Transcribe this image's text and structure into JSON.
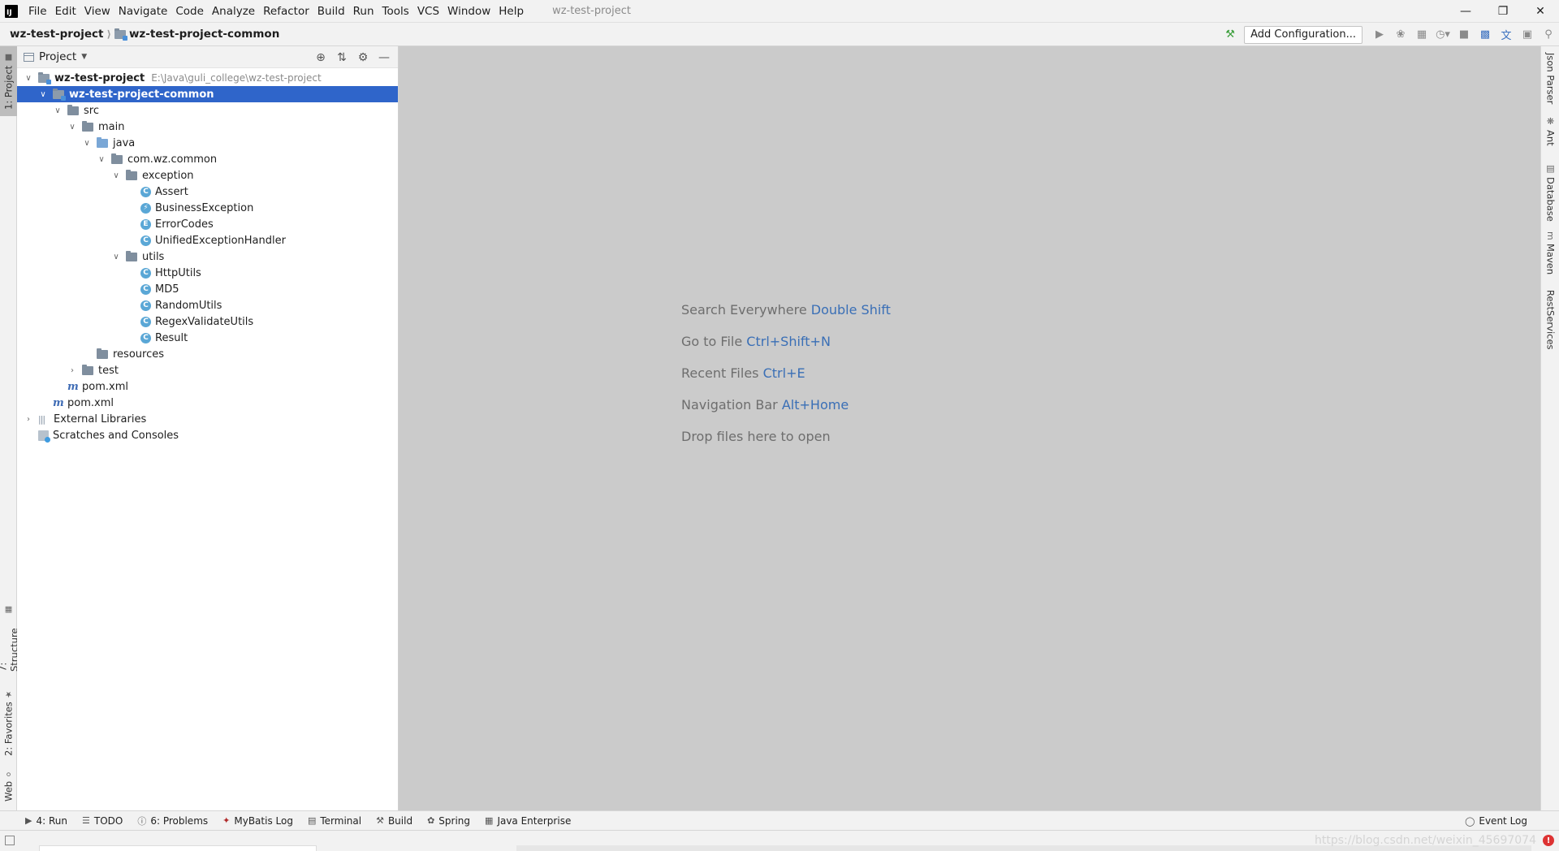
{
  "menu": {
    "items": [
      {
        "name": "file",
        "label": "File"
      },
      {
        "name": "edit",
        "label": "Edit"
      },
      {
        "name": "view",
        "label": "View"
      },
      {
        "name": "navigate",
        "label": "Navigate"
      },
      {
        "name": "code",
        "label": "Code"
      },
      {
        "name": "analyze",
        "label": "Analyze"
      },
      {
        "name": "refactor",
        "label": "Refactor"
      },
      {
        "name": "build",
        "label": "Build"
      },
      {
        "name": "run",
        "label": "Run"
      },
      {
        "name": "tools",
        "label": "Tools"
      },
      {
        "name": "vcs",
        "label": "VCS"
      },
      {
        "name": "window",
        "label": "Window"
      },
      {
        "name": "help",
        "label": "Help"
      }
    ],
    "window_title": "wz-test-project"
  },
  "navbar": {
    "crumbs": [
      "wz-test-project",
      "wz-test-project-common"
    ],
    "add_config_label": "Add Configuration..."
  },
  "left_stripe": {
    "tabs": [
      "1: Project",
      "7: Structure",
      "2: Favorites",
      "Web"
    ]
  },
  "project_panel": {
    "title": "Project",
    "root_path": "E:\\Java\\guli_college\\wz-test-project",
    "tree": [
      {
        "label": "wz-test-project",
        "level": 0,
        "expanded": true,
        "icon": "module-folder",
        "bold": true,
        "path": true
      },
      {
        "label": "wz-test-project-common",
        "level": 1,
        "expanded": true,
        "icon": "module-folder",
        "bold": true,
        "selected": true
      },
      {
        "label": "src",
        "level": 2,
        "expanded": true,
        "icon": "folder"
      },
      {
        "label": "main",
        "level": 3,
        "expanded": true,
        "icon": "folder"
      },
      {
        "label": "java",
        "level": 4,
        "expanded": true,
        "icon": "source-folder"
      },
      {
        "label": "com.wz.common",
        "level": 5,
        "expanded": true,
        "icon": "package"
      },
      {
        "label": "exception",
        "level": 6,
        "expanded": true,
        "icon": "package"
      },
      {
        "label": "Assert",
        "level": 7,
        "icon": "class"
      },
      {
        "label": "BusinessException",
        "level": 7,
        "icon": "exception-class"
      },
      {
        "label": "ErrorCodes",
        "level": 7,
        "icon": "enum"
      },
      {
        "label": "UnifiedExceptionHandler",
        "level": 7,
        "icon": "class"
      },
      {
        "label": "utils",
        "level": 6,
        "expanded": true,
        "icon": "package"
      },
      {
        "label": "HttpUtils",
        "level": 7,
        "icon": "class"
      },
      {
        "label": "MD5",
        "level": 7,
        "icon": "class"
      },
      {
        "label": "RandomUtils",
        "level": 7,
        "icon": "class"
      },
      {
        "label": "RegexValidateUtils",
        "level": 7,
        "icon": "class"
      },
      {
        "label": "Result",
        "level": 7,
        "icon": "class"
      },
      {
        "label": "resources",
        "level": 4,
        "icon": "resources-folder"
      },
      {
        "label": "test",
        "level": 3,
        "expanded": false,
        "icon": "folder"
      },
      {
        "label": "pom.xml",
        "level": 2,
        "icon": "maven"
      },
      {
        "label": "pom.xml",
        "level": 1,
        "icon": "maven"
      },
      {
        "label": "External Libraries",
        "level": 0,
        "expanded": false,
        "icon": "libraries"
      },
      {
        "label": "Scratches and Consoles",
        "level": 0,
        "icon": "scratches"
      }
    ]
  },
  "editor": {
    "hints": [
      {
        "text": "Search Everywhere",
        "key": "Double Shift"
      },
      {
        "text": "Go to File",
        "key": "Ctrl+Shift+N"
      },
      {
        "text": "Recent Files",
        "key": "Ctrl+E"
      },
      {
        "text": "Navigation Bar",
        "key": "Alt+Home"
      },
      {
        "text": "Drop files here to open",
        "key": ""
      }
    ]
  },
  "right_stripe": {
    "tabs": [
      "Json Parser",
      "Ant",
      "Database",
      "Maven",
      "RestServices"
    ]
  },
  "bottom_bar": {
    "tools": [
      {
        "name": "run",
        "label": "4: Run"
      },
      {
        "name": "todo",
        "label": "TODO"
      },
      {
        "name": "problems",
        "label": "6: Problems"
      },
      {
        "name": "mybatis-log",
        "label": "MyBatis Log"
      },
      {
        "name": "terminal",
        "label": "Terminal"
      },
      {
        "name": "build",
        "label": "Build"
      },
      {
        "name": "spring",
        "label": "Spring"
      },
      {
        "name": "java-enterprise",
        "label": "Java Enterprise"
      }
    ],
    "event_log": "Event Log"
  },
  "status_bar": {
    "watermark": "https://blog.csdn.net/weixin_45697074"
  }
}
